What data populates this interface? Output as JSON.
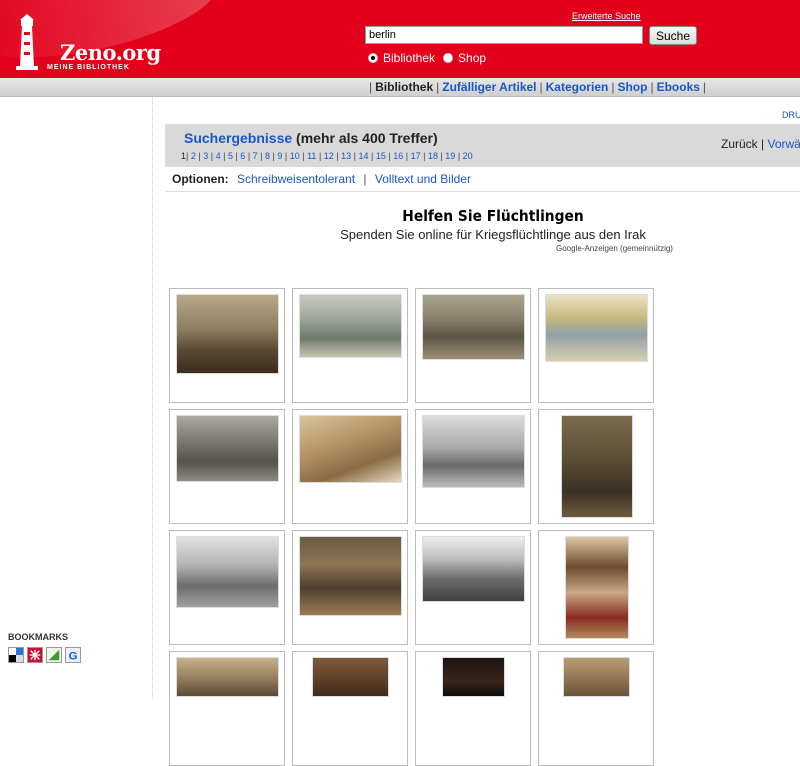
{
  "header": {
    "logo_text": "Zeno.org",
    "logo_subtitle": "MEINE BIBLIOTHEK",
    "advanced_search": "Erweiterte Suche",
    "search_value": "berlin",
    "search_button": "Suche",
    "radio_bibliothek": "Bibliothek",
    "radio_shop": "Shop",
    "brand_color": "#e2001a"
  },
  "nav": {
    "items": [
      {
        "label": "Bibliothek"
      },
      {
        "label": "Zufälliger Artikel"
      },
      {
        "label": "Kategorien"
      },
      {
        "label": "Shop"
      },
      {
        "label": "Ebooks"
      }
    ]
  },
  "main": {
    "druck": "DRU",
    "results_link": "Suchergebnisse",
    "results_count": " (mehr als 400 Treffer)",
    "pages": [
      "1",
      "2",
      "3",
      "4",
      "5",
      "6",
      "7",
      "8",
      "9",
      "10",
      "11",
      "12",
      "13",
      "14",
      "15",
      "16",
      "17",
      "18",
      "19",
      "20"
    ],
    "back": "Zurück",
    "forward": "Vorwärt",
    "options_label": "Optionen:",
    "option1": "Schreibweisentolerant",
    "option2": "Volltext und Bilder"
  },
  "ad": {
    "title": "Helfen Sie Flüchtlingen",
    "subtitle": "Spenden Sie online für Kriegsflüchtlinge aus den Irak",
    "note": "Google-Anzeigen (gemeinnützig)"
  },
  "sidebar": {
    "bookmarks_title": "BOOKMARKS",
    "bookmark_icons": [
      "delicious-icon",
      "mrwong-icon",
      "linkarena-icon",
      "google-bookmarks-icon"
    ]
  }
}
